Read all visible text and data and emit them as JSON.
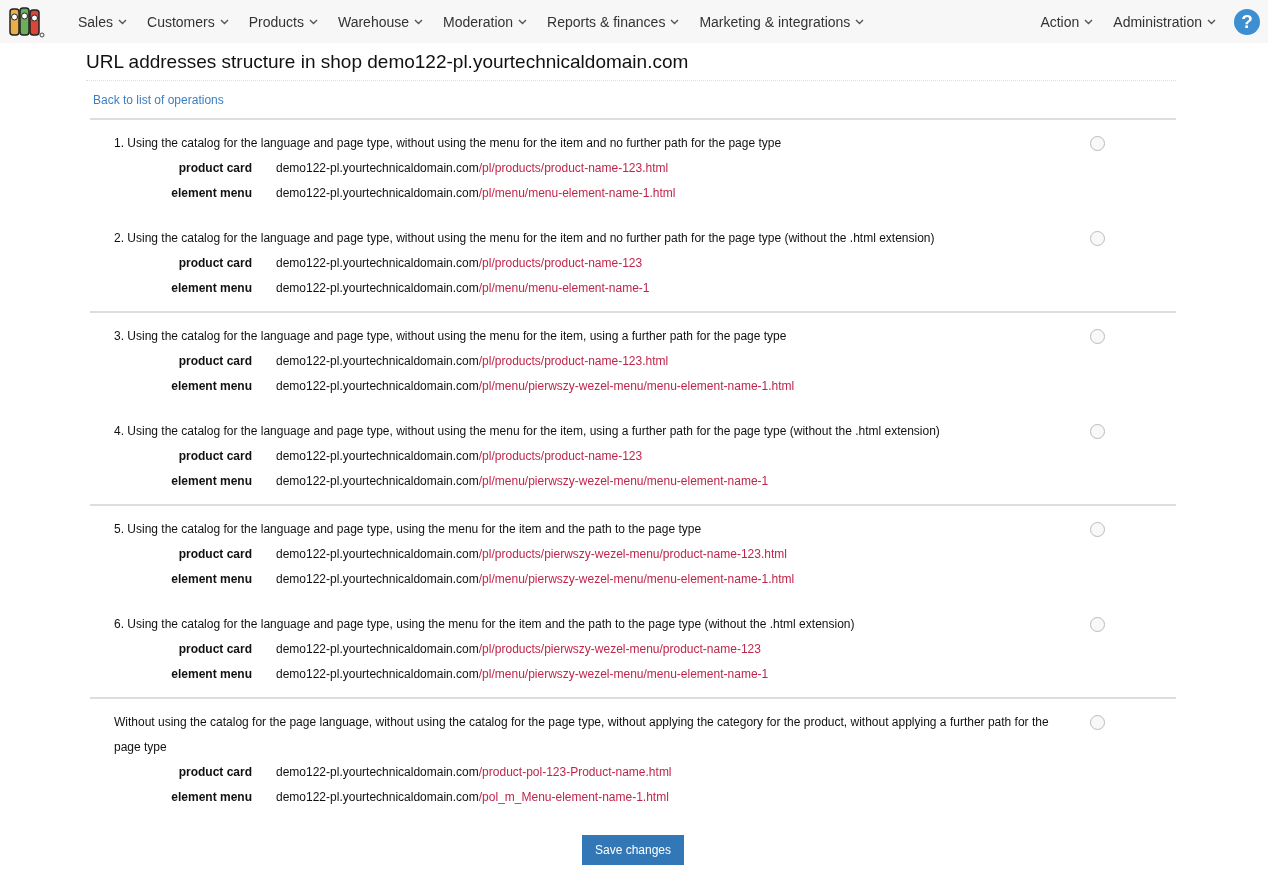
{
  "nav": {
    "menus": [
      {
        "label": "Sales"
      },
      {
        "label": "Customers"
      },
      {
        "label": "Products"
      },
      {
        "label": "Warehouse"
      },
      {
        "label": "Moderation"
      },
      {
        "label": "Reports & finances"
      },
      {
        "label": "Marketing & integrations"
      }
    ],
    "right_menus": [
      {
        "label": "Action"
      },
      {
        "label": "Administration"
      }
    ],
    "help": "?"
  },
  "title": "URL addresses structure in shop demo122-pl.yourtechnicaldomain.com",
  "back_link": "Back to list of operations",
  "groups": [
    {
      "options": [
        {
          "description": "1. Using the catalog for the language and page type, without using the menu for the item and no further path for the page type",
          "selected": false,
          "urls": [
            {
              "label": "product card",
              "host": "demo122-pl.yourtechnicaldomain.com",
              "path": "/pl/products/product-name-123.html"
            },
            {
              "label": "element menu",
              "host": "demo122-pl.yourtechnicaldomain.com",
              "path": "/pl/menu/menu-element-name-1.html"
            }
          ]
        },
        {
          "description": "2. Using the catalog for the language and page type, without using the menu for the item and no further path for the page type (without the .html extension)",
          "selected": false,
          "urls": [
            {
              "label": "product card",
              "host": "demo122-pl.yourtechnicaldomain.com",
              "path": "/pl/products/product-name-123"
            },
            {
              "label": "element menu",
              "host": "demo122-pl.yourtechnicaldomain.com",
              "path": "/pl/menu/menu-element-name-1"
            }
          ]
        }
      ]
    },
    {
      "options": [
        {
          "description": "3. Using the catalog for the language and page type, without using the menu for the item, using a further path for the page type",
          "selected": false,
          "urls": [
            {
              "label": "product card",
              "host": "demo122-pl.yourtechnicaldomain.com",
              "path": "/pl/products/product-name-123.html"
            },
            {
              "label": "element menu",
              "host": "demo122-pl.yourtechnicaldomain.com",
              "path": "/pl/menu/pierwszy-wezel-menu/menu-element-name-1.html"
            }
          ]
        },
        {
          "description": "4. Using the catalog for the language and page type, without using the menu for the item, using a further path for the page type (without the .html extension)",
          "selected": false,
          "urls": [
            {
              "label": "product card",
              "host": "demo122-pl.yourtechnicaldomain.com",
              "path": "/pl/products/product-name-123"
            },
            {
              "label": "element menu",
              "host": "demo122-pl.yourtechnicaldomain.com",
              "path": "/pl/menu/pierwszy-wezel-menu/menu-element-name-1"
            }
          ]
        }
      ]
    },
    {
      "options": [
        {
          "description": "5. Using the catalog for the language and page type, using the menu for the item and the path to the page type",
          "selected": false,
          "urls": [
            {
              "label": "product card",
              "host": "demo122-pl.yourtechnicaldomain.com",
              "path": "/pl/products/pierwszy-wezel-menu/product-name-123.html"
            },
            {
              "label": "element menu",
              "host": "demo122-pl.yourtechnicaldomain.com",
              "path": "/pl/menu/pierwszy-wezel-menu/menu-element-name-1.html"
            }
          ]
        },
        {
          "description": "6. Using the catalog for the language and page type, using the menu for the item and the path to the page type (without the .html extension)",
          "selected": false,
          "urls": [
            {
              "label": "product card",
              "host": "demo122-pl.yourtechnicaldomain.com",
              "path": "/pl/products/pierwszy-wezel-menu/product-name-123"
            },
            {
              "label": "element menu",
              "host": "demo122-pl.yourtechnicaldomain.com",
              "path": "/pl/menu/pierwszy-wezel-menu/menu-element-name-1"
            }
          ]
        }
      ]
    },
    {
      "options": [
        {
          "description": "Without using the catalog for the page language, without using the catalog for the page type, without applying the category for the product, without applying a further path for the page type",
          "selected": false,
          "urls": [
            {
              "label": "product card",
              "host": "demo122-pl.yourtechnicaldomain.com",
              "path": "/product-pol-123-Product-name.html"
            },
            {
              "label": "element menu",
              "host": "demo122-pl.yourtechnicaldomain.com",
              "path": "/pol_m_Menu-element-name-1.html"
            }
          ]
        }
      ]
    }
  ],
  "save_button": "Save changes"
}
